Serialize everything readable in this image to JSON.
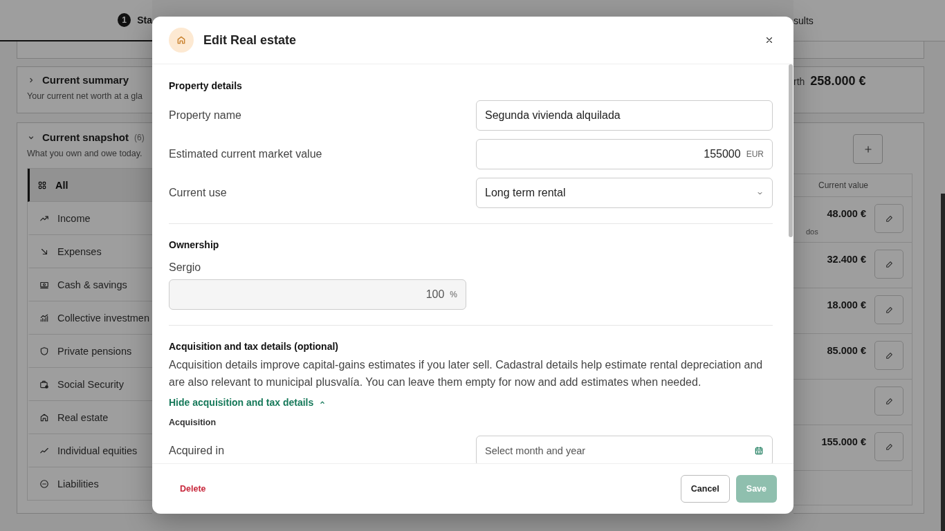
{
  "stepper": {
    "steps": [
      {
        "number": "1",
        "label": "Sta",
        "selected": true
      },
      {
        "label": "sults",
        "selected": false
      }
    ]
  },
  "summary": {
    "title": "Current summary",
    "subtitle": "Your current net worth at a gla",
    "expanded": false,
    "net_worth_label": "rth",
    "net_worth": "258.000 €"
  },
  "snapshot": {
    "title": "Current snapshot",
    "count": "(6)",
    "subtitle": "What you own and owe today.",
    "expanded": true,
    "categories": [
      {
        "label": "All",
        "selected": true
      },
      {
        "label": "Income",
        "selected": false
      },
      {
        "label": "Expenses",
        "selected": false
      },
      {
        "label": "Cash & savings",
        "selected": false
      },
      {
        "label": "Collective investmen",
        "selected": false
      },
      {
        "label": "Private pensions",
        "selected": false
      },
      {
        "label": "Social Security",
        "selected": false
      },
      {
        "label": "Real estate",
        "selected": false
      },
      {
        "label": "Individual equities",
        "selected": false
      },
      {
        "label": "Liabilities",
        "selected": false
      }
    ],
    "value_header": "Current value",
    "rows": [
      {
        "value": "48.000 €",
        "note": "dos"
      },
      {
        "value": "32.400 €"
      },
      {
        "value": "18.000 €"
      },
      {
        "value": "85.000 €"
      },
      {},
      {
        "value": "155.000 €"
      }
    ]
  },
  "dialog": {
    "title": "Edit Real estate",
    "property_details": {
      "heading": "Property details",
      "fields": [
        {
          "kind": "text",
          "label": "Property name",
          "value": "Segunda vivienda alquilada"
        },
        {
          "kind": "number",
          "label": "Estimated current market value",
          "value": "155000",
          "unit": "EUR"
        },
        {
          "kind": "select",
          "label": "Current use",
          "value": "Long term rental"
        }
      ]
    },
    "ownership": {
      "heading": "Ownership",
      "owners": [
        {
          "name": "Sergio",
          "value": "100",
          "unit": "%",
          "disabled": true
        }
      ]
    },
    "acquisition": {
      "heading": "Acquisition and tax details (optional)",
      "description": "Acquisition details improve capital-gains estimates if you later sell. Cadastral details help estimate rental depreciation and are also relevant to municipal plusvalía. You can leave them empty for now and add estimates when needed.",
      "toggle": "Hide acquisition and tax details",
      "expanded": true,
      "subheading": "Acquisition",
      "fields": [
        {
          "kind": "month",
          "label": "Acquired in",
          "placeholder": "Select month and year"
        }
      ]
    },
    "footer": {
      "delete": "Delete",
      "cancel": "Cancel",
      "save": {
        "label": "Save",
        "disabled": true
      }
    }
  }
}
